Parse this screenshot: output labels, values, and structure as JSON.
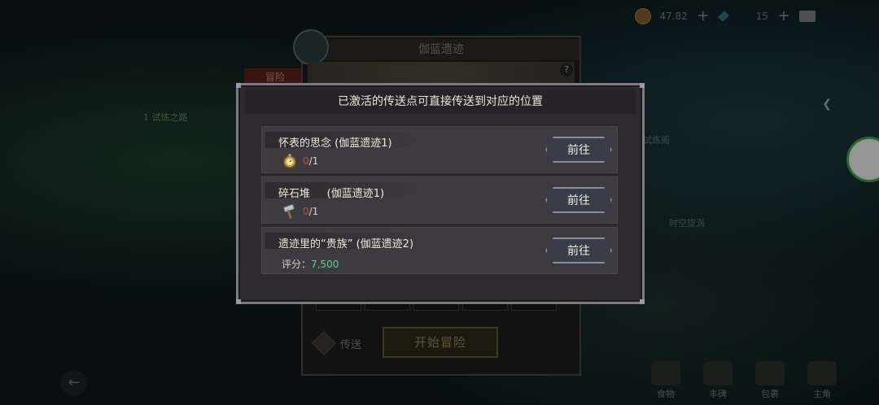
{
  "hud": {
    "currency_value": "47.82",
    "gem_value": "15"
  },
  "map_labels": {
    "quest": "1 试炼之路",
    "trial_tower": "试炼阁",
    "time_rift": "时空旋涡"
  },
  "underlay": {
    "title": "伽蓝遗迹",
    "side_tab": "冒险",
    "teleport_label": "传送",
    "start_button": "开始冒险",
    "help_icon": "?"
  },
  "dialog": {
    "title": "已激活的传送点可直接传送到对应的位置",
    "rows": [
      {
        "title": "怀表的思念 (伽蓝遗迹1)",
        "item_icon": "pocket-watch-icon",
        "have": "0",
        "need": "/1",
        "button": "前往"
      },
      {
        "title": "碎石堆     (伽蓝遗迹1)",
        "item_icon": "hammer-icon",
        "have": "0",
        "need": "/1",
        "button": "前往"
      },
      {
        "title": "遗迹里的“贵族” (伽蓝遗迹2)",
        "score_label": "评分：",
        "score_value": "7,500",
        "button": "前往"
      }
    ]
  },
  "bottom_menu": [
    "食物",
    "丰碑",
    "包裹",
    "主角"
  ]
}
